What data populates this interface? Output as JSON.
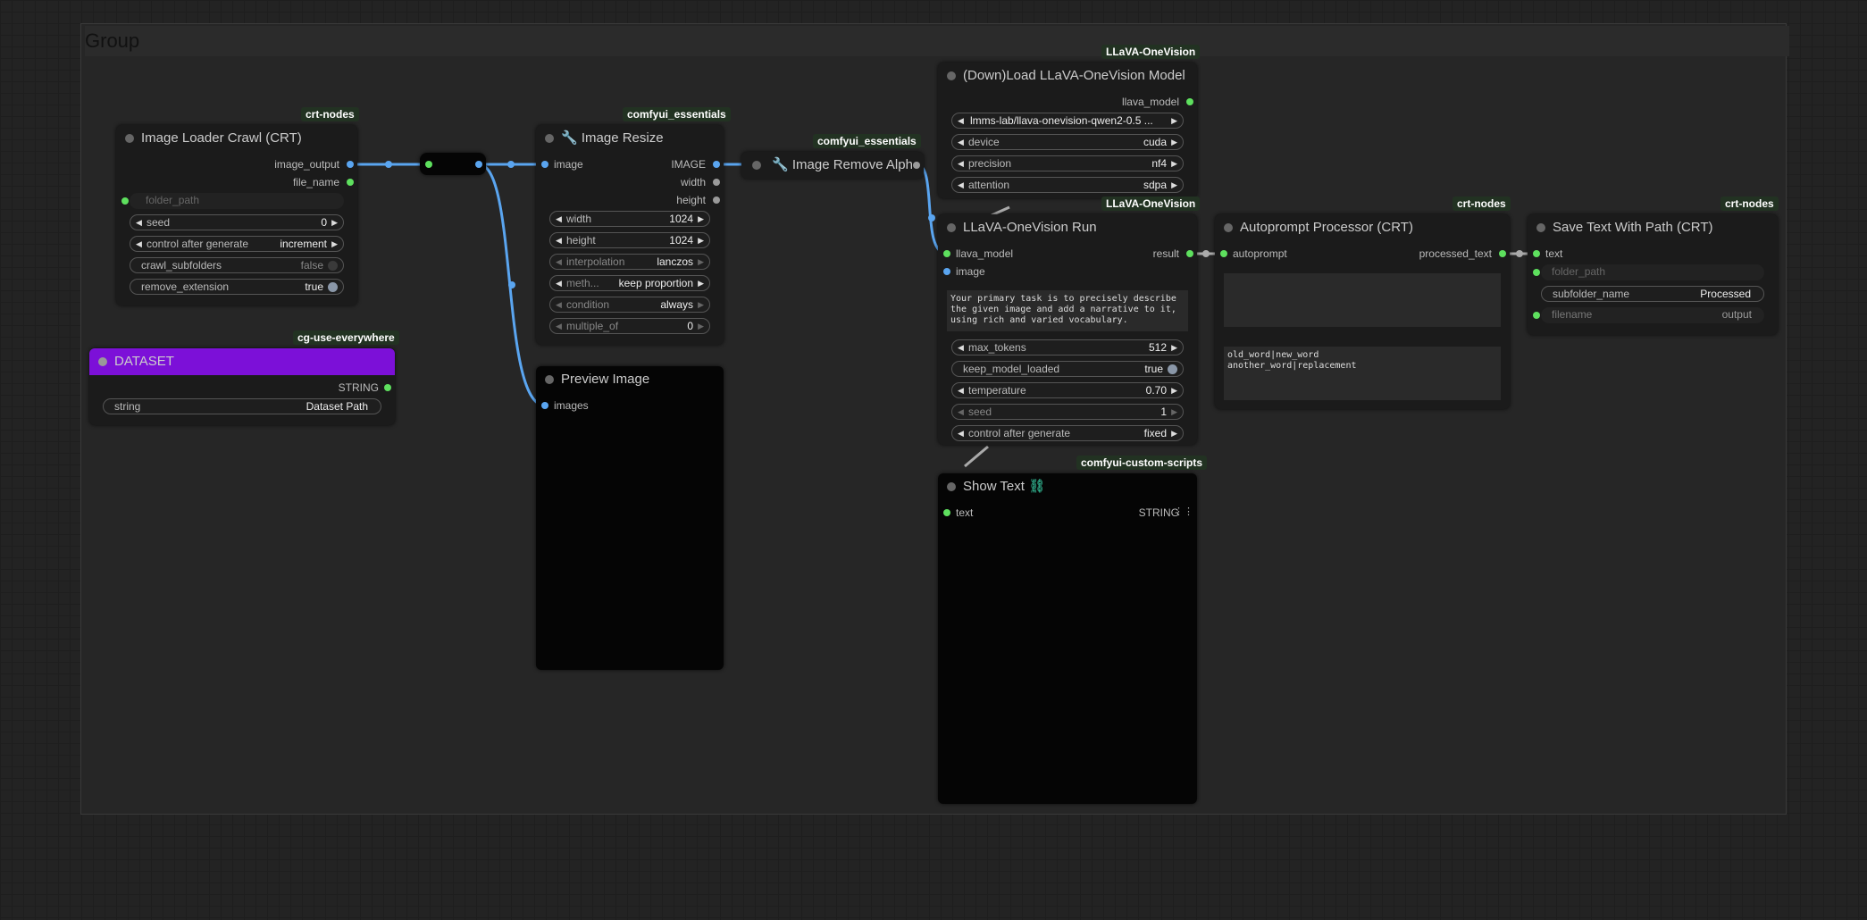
{
  "group": {
    "title": "Group"
  },
  "nodes": {
    "loader": {
      "badge": "crt-nodes",
      "title": "Image Loader Crawl (CRT)",
      "out_image": "image_output",
      "out_file": "file_name",
      "folder_path": "folder_path",
      "seed_label": "seed",
      "seed_value": "0",
      "cag_label": "control after generate",
      "cag_value": "increment",
      "crawl_label": "crawl_subfolders",
      "crawl_value": "false",
      "remove_label": "remove_extension",
      "remove_value": "true"
    },
    "dataset": {
      "badge": "cg-use-everywhere",
      "title": "DATASET",
      "out_string": "STRING",
      "string_label": "string",
      "string_value": "Dataset Path",
      "color": "#7c10d8"
    },
    "resize": {
      "badge": "comfyui_essentials",
      "title": "Image Resize",
      "in_image": "image",
      "out_image": "IMAGE",
      "out_width": "width",
      "out_height": "height",
      "width_label": "width",
      "width_value": "1024",
      "height_label": "height",
      "height_value": "1024",
      "interp_label": "interpolation",
      "interp_value": "lanczos",
      "method_label": "meth...",
      "method_value": "keep proportion",
      "cond_label": "condition",
      "cond_value": "always",
      "mult_label": "multiple_of",
      "mult_value": "0"
    },
    "preview": {
      "title": "Preview Image",
      "in_images": "images"
    },
    "remove_alpha": {
      "badge": "comfyui_essentials",
      "title": "Image Remove Alph"
    },
    "llava_load": {
      "badge": "LLaVA-OneVision",
      "title": "(Down)Load LLaVA-OneVision Model",
      "out_model": "llava_model",
      "model_value": "lmms-lab/llava-onevision-qwen2-0.5 ...",
      "device_label": "device",
      "device_value": "cuda",
      "precision_label": "precision",
      "precision_value": "nf4",
      "attention_label": "attention",
      "attention_value": "sdpa"
    },
    "llava_run": {
      "badge": "LLaVA-OneVision",
      "title": "LLaVA-OneVision Run",
      "in_model": "llava_model",
      "in_image": "image",
      "out_result": "result",
      "prompt": "Your primary task is to precisely describe the given image and add a narrative to it, using rich and varied vocabulary.",
      "max_tokens_label": "max_tokens",
      "max_tokens_value": "512",
      "keep_label": "keep_model_loaded",
      "keep_value": "true",
      "temp_label": "temperature",
      "temp_value": "0.70",
      "seed_label": "seed",
      "seed_value": "1",
      "cag_label": "control after generate",
      "cag_value": "fixed"
    },
    "show_text": {
      "badge": "comfyui-custom-scripts",
      "title": "Show Text",
      "in_text": "text",
      "out_string": "STRING"
    },
    "autoprompt": {
      "badge": "crt-nodes",
      "title": "Autoprompt Processor (CRT)",
      "in_autoprompt": "autoprompt",
      "out_processed": "processed_text",
      "replace_text": "old_word|new_word\nanother_word|replacement"
    },
    "save_text": {
      "badge": "crt-nodes",
      "title": "Save Text With Path (CRT)",
      "in_text": "text",
      "folder_path": "folder_path",
      "subfolder_label": "subfolder_name",
      "subfolder_value": "Processed",
      "filename_label": "filename",
      "filename_value": "output"
    }
  }
}
